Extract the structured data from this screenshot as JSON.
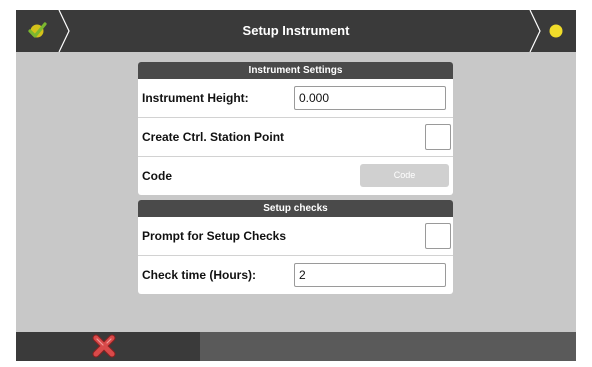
{
  "header": {
    "title": "Setup Instrument",
    "left_icon": "check-logo-icon",
    "right_icon": "status-dot-icon",
    "status_color": "#f0dc2a",
    "logo_colors": [
      "#d4c21a",
      "#7cb82f"
    ]
  },
  "instrument_settings": {
    "heading": "Instrument Settings",
    "height_label": "Instrument Height:",
    "height_value": "0.000",
    "control_point_label": "Create Ctrl. Station Point",
    "code_label": "Code",
    "code_button": "Code"
  },
  "setup_checks": {
    "heading": "Setup checks",
    "prompt_label": "Prompt for Setup Checks",
    "check_time_label": "Check time (Hours):",
    "check_time_value": "2"
  },
  "footer": {
    "cancel_icon": "cancel-x-icon",
    "cancel_color": "#d94a4a"
  }
}
